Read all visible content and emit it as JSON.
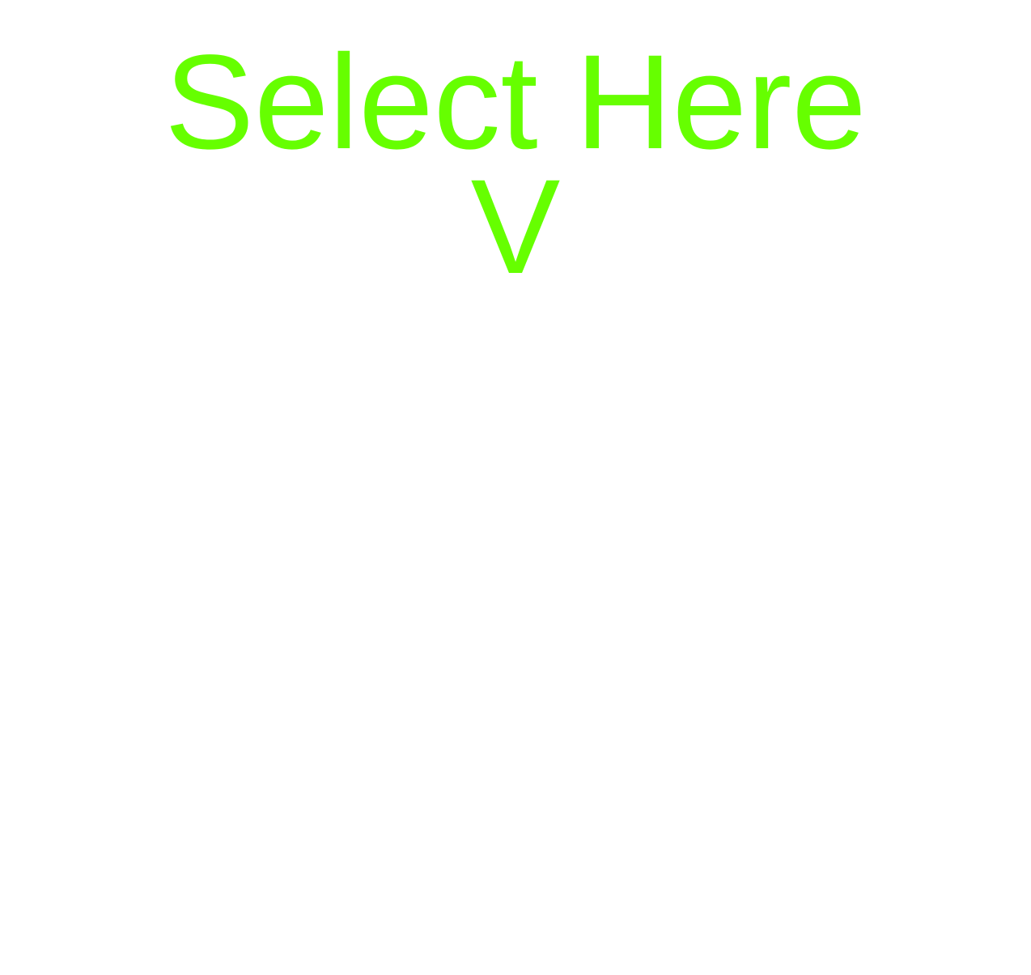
{
  "colors": {
    "background": "#ffffff",
    "accent": "#66ff00"
  },
  "select": {
    "label": "Select Here",
    "arrow": "V"
  }
}
